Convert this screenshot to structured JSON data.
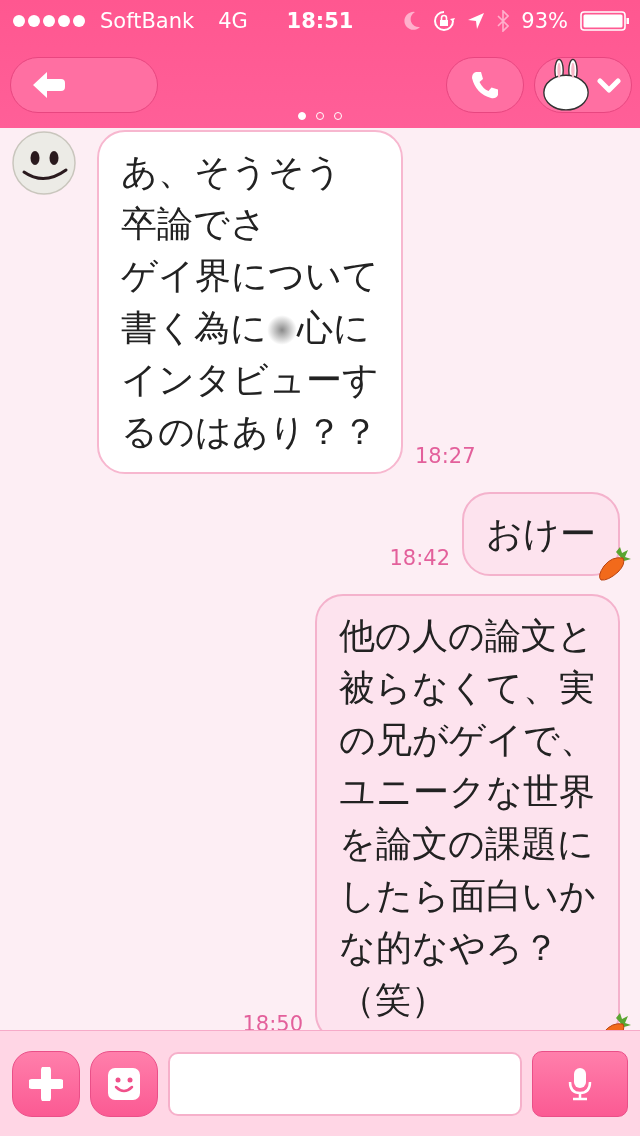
{
  "status_bar": {
    "carrier": "SoftBank",
    "network": "4G",
    "time": "18:51",
    "battery": "93%"
  },
  "header": {
    "pages": [
      {
        "selected": true
      },
      {
        "selected": false
      },
      {
        "selected": false
      }
    ]
  },
  "messages": [
    {
      "kind": "received",
      "lines": [
        [
          "あ、そうそう"
        ],
        [
          "卒論でさ"
        ],
        [
          "ゲイ界について"
        ],
        [
          "書く為に",
          "心に"
        ],
        [
          "インタビューす"
        ],
        [
          "るのはあり？？"
        ]
      ],
      "time": "18:27"
    },
    {
      "kind": "sent",
      "lines": [
        [
          "おけー"
        ]
      ],
      "time": "18:42"
    },
    {
      "kind": "sent",
      "lines": [
        [
          "他の人の論文と"
        ],
        [
          "被らなくて、実"
        ],
        [
          "の兄がゲイで、"
        ],
        [
          "ユニークな世界"
        ],
        [
          "を論文の課題に"
        ],
        [
          "したら面白いか"
        ],
        [
          "な的なやろ？"
        ],
        [
          "（笑）"
        ]
      ],
      "time": "18:50"
    }
  ]
}
